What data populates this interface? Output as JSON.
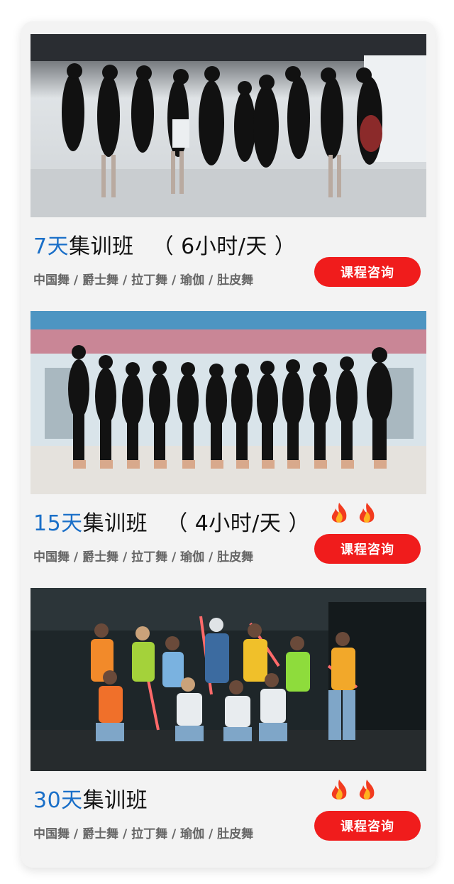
{
  "courses": [
    {
      "days": "7天",
      "name": "集训班",
      "hours": "（ 6小时/天 ）",
      "subjects": "中国舞 / 爵士舞 / 拉丁舞 / 瑜伽 / 肚皮舞",
      "button_label": "课程咨询",
      "hot": false,
      "photo": "latin-dance-group-studio-photo"
    },
    {
      "days": "15天",
      "name": "集训班",
      "hours": "（ 4小时/天 ）",
      "subjects": "中国舞 / 爵士舞 / 拉丁舞 / 瑜伽 / 肚皮舞",
      "button_label": "课程咨询",
      "hot": true,
      "photo": "ballet-class-group-studio-photo"
    },
    {
      "days": "30天",
      "name": "集训班",
      "hours": "",
      "subjects": "中国舞 / 爵士舞 / 拉丁舞 / 瑜伽 / 肚皮舞",
      "button_label": "课程咨询",
      "hot": true,
      "photo": "hiphop-crew-night-photo"
    }
  ],
  "colors": {
    "days_accent": "#1a6fc8",
    "button": "#f01c1c",
    "panel": "#f3f3f3"
  }
}
